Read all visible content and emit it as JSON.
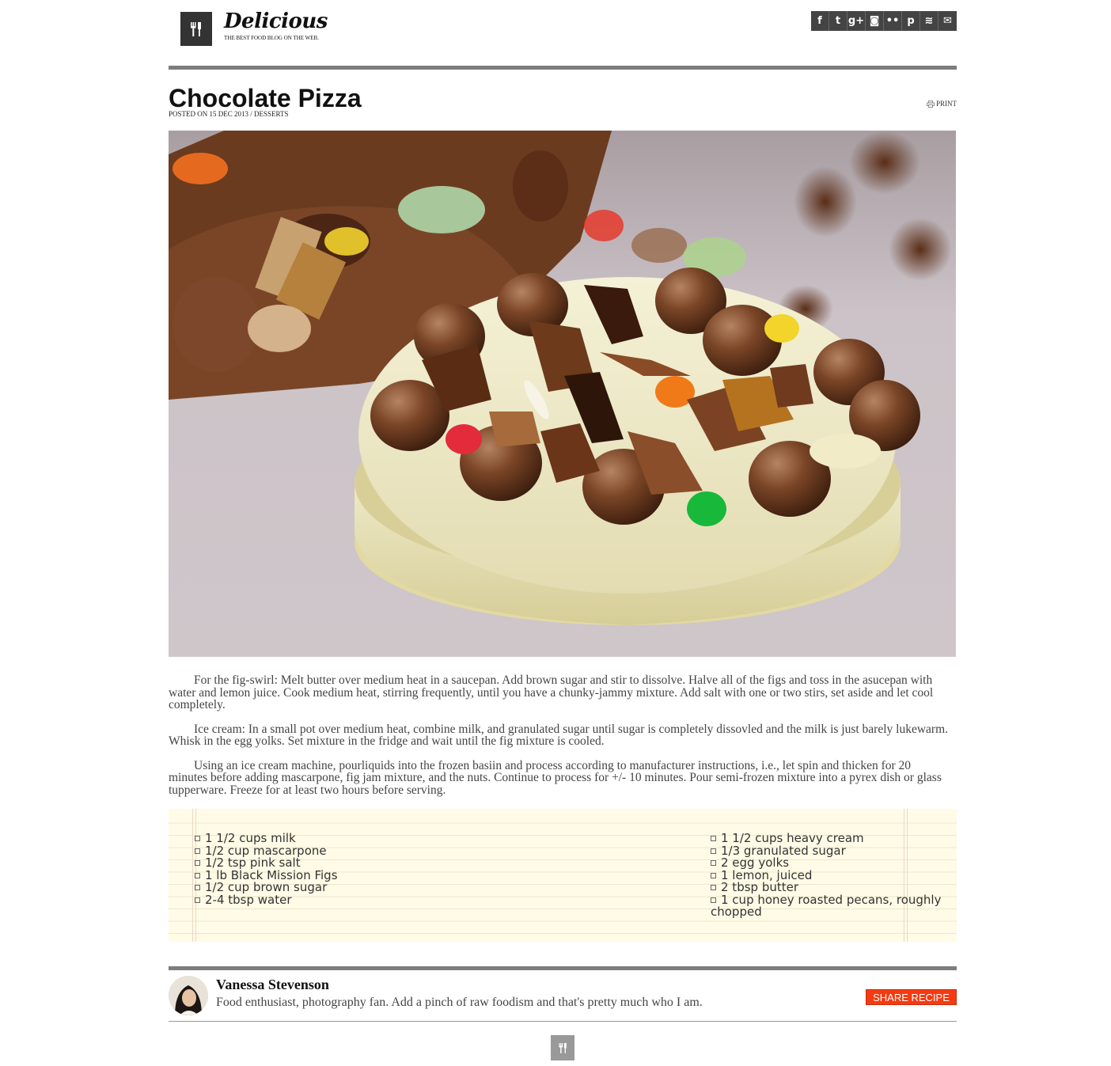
{
  "header": {
    "brand_name": "Delicious",
    "tagline": "THE BEST FOOD BLOG ON THE WEB.",
    "social": [
      {
        "name": "facebook-icon",
        "glyph": "f"
      },
      {
        "name": "twitter-icon",
        "glyph": "t"
      },
      {
        "name": "googleplus-icon",
        "glyph": "g+"
      },
      {
        "name": "instagram-icon",
        "glyph": "◙"
      },
      {
        "name": "flickr-icon",
        "glyph": "••"
      },
      {
        "name": "pinterest-icon",
        "glyph": "p"
      },
      {
        "name": "rss-icon",
        "glyph": "≋"
      },
      {
        "name": "mail-icon",
        "glyph": "✉"
      }
    ]
  },
  "post": {
    "title": "Chocolate Pizza",
    "meta": "POSTED ON 15 DEC 2013 / DESSERTS",
    "print_label": "PRINT",
    "paragraphs": [
      "For the fig-swirl: Melt butter over medium heat in a saucepan. Add brown sugar and stir to dissolve. Halve all of the figs and toss in the asucepan with water and lemon juice. Cook medium heat, stirring frequently, until you have a chunky-jammy mixture. Add salt with one or two stirs, set aside and let cool completely.",
      "Ice cream: In a small pot over medium heat, combine milk, and granulated sugar until sugar is completely dissovled and the milk is just barely lukewarm. Whisk in the egg yolks. Set mixture in the fridge and wait until the fig mixture is cooled.",
      "Using an ice cream machine, pourliquids into the frozen basiin and process according to manufacturer instructions, i.e., let spin and thicken for 20 minutes before adding mascarpone, fig jam mixture, and the nuts. Continue to process for +/- 10 minutes. Pour semi-frozen mixture into a pyrex dish or glass tupperware. Freeze for at least two hours before serving."
    ]
  },
  "ingredients": {
    "left": [
      "1 1/2 cups milk",
      "1/2 cup mascarpone",
      "1/2 tsp pink salt",
      "1 lb Black Mission Figs",
      "1/2 cup brown sugar",
      "2-4 tbsp water"
    ],
    "right": [
      "1 1/2 cups heavy cream",
      "1/3 granulated sugar",
      "2 egg yolks",
      "1 lemon, juiced",
      "2 tbsp butter",
      "1 cup honey roasted pecans, roughly chopped"
    ]
  },
  "author": {
    "name": "Vanessa Stevenson",
    "bio": "Food enthusiast, photography fan. Add a pinch of raw foodism and that's pretty much who I am.",
    "share_label": "SHARE RECIPE"
  },
  "colors": {
    "accent": "#f33b12",
    "rule": "#7d7d7d",
    "logo_bg": "#333333",
    "paper": "#fffbe6"
  }
}
